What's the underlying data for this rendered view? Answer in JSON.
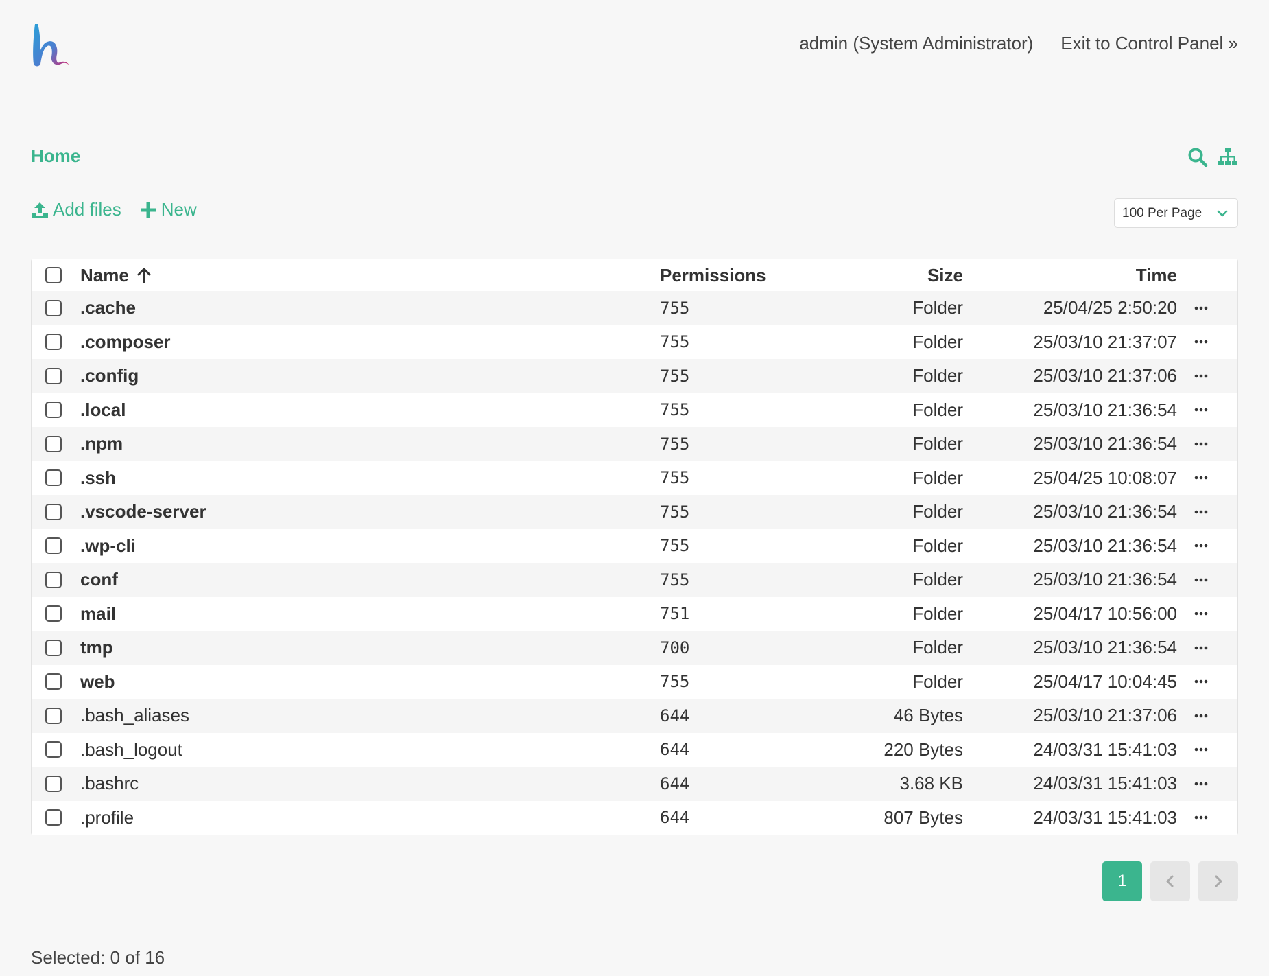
{
  "header": {
    "user_label": "admin (System Administrator)",
    "exit_label": "Exit to Control Panel »"
  },
  "breadcrumb": {
    "home": "Home"
  },
  "toolbar": {
    "add_files": "Add files",
    "new": "New",
    "per_page": "100 Per Page"
  },
  "table": {
    "columns": {
      "name": "Name",
      "permissions": "Permissions",
      "size": "Size",
      "time": "Time"
    },
    "rows": [
      {
        "name": ".cache",
        "permissions": "755",
        "size": "Folder",
        "time": "25/04/25 2:50:20",
        "folder": true
      },
      {
        "name": ".composer",
        "permissions": "755",
        "size": "Folder",
        "time": "25/03/10 21:37:07",
        "folder": true
      },
      {
        "name": ".config",
        "permissions": "755",
        "size": "Folder",
        "time": "25/03/10 21:37:06",
        "folder": true
      },
      {
        "name": ".local",
        "permissions": "755",
        "size": "Folder",
        "time": "25/03/10 21:36:54",
        "folder": true
      },
      {
        "name": ".npm",
        "permissions": "755",
        "size": "Folder",
        "time": "25/03/10 21:36:54",
        "folder": true
      },
      {
        "name": ".ssh",
        "permissions": "755",
        "size": "Folder",
        "time": "25/04/25 10:08:07",
        "folder": true
      },
      {
        "name": ".vscode-server",
        "permissions": "755",
        "size": "Folder",
        "time": "25/03/10 21:36:54",
        "folder": true
      },
      {
        "name": ".wp-cli",
        "permissions": "755",
        "size": "Folder",
        "time": "25/03/10 21:36:54",
        "folder": true
      },
      {
        "name": "conf",
        "permissions": "755",
        "size": "Folder",
        "time": "25/03/10 21:36:54",
        "folder": true
      },
      {
        "name": "mail",
        "permissions": "751",
        "size": "Folder",
        "time": "25/04/17 10:56:00",
        "folder": true
      },
      {
        "name": "tmp",
        "permissions": "700",
        "size": "Folder",
        "time": "25/03/10 21:36:54",
        "folder": true
      },
      {
        "name": "web",
        "permissions": "755",
        "size": "Folder",
        "time": "25/04/17 10:04:45",
        "folder": true
      },
      {
        "name": ".bash_aliases",
        "permissions": "644",
        "size": "46 Bytes",
        "time": "25/03/10 21:37:06",
        "folder": false
      },
      {
        "name": ".bash_logout",
        "permissions": "644",
        "size": "220 Bytes",
        "time": "24/03/31 15:41:03",
        "folder": false
      },
      {
        "name": ".bashrc",
        "permissions": "644",
        "size": "3.68 KB",
        "time": "24/03/31 15:41:03",
        "folder": false
      },
      {
        "name": ".profile",
        "permissions": "644",
        "size": "807 Bytes",
        "time": "24/03/31 15:41:03",
        "folder": false
      }
    ]
  },
  "pagination": {
    "current": "1"
  },
  "status": {
    "selected": "Selected: 0 of 16"
  },
  "colors": {
    "accent": "#3bb58e",
    "logo_blue": "#2a9fd8",
    "logo_pink": "#d6246e"
  },
  "icons": [
    "logo",
    "search-icon",
    "sitemap-icon",
    "upload-icon",
    "plus-icon",
    "chevron-down-icon",
    "sort-up-icon",
    "more-icon",
    "chevron-left-icon",
    "chevron-right-icon"
  ]
}
